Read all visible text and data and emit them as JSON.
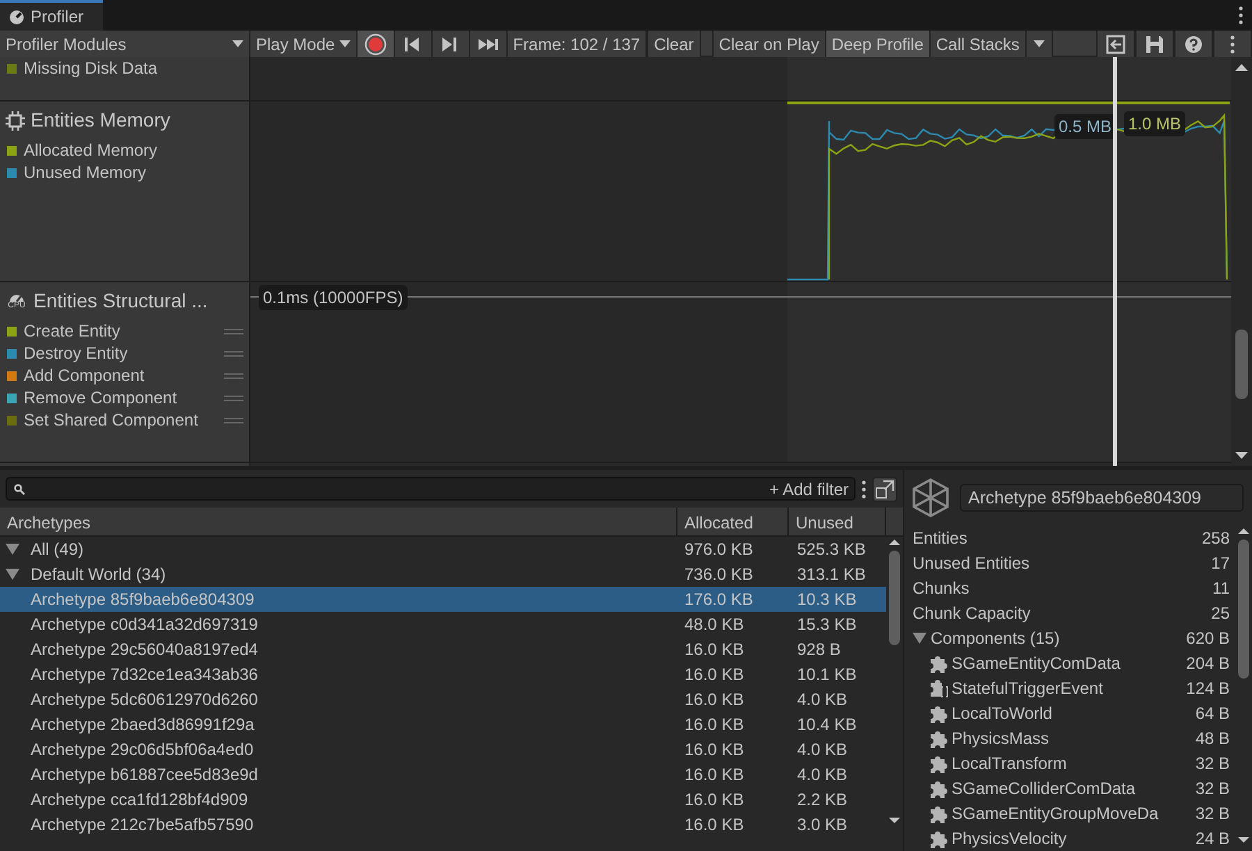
{
  "window": {
    "title": "Profiler"
  },
  "toolbar": {
    "modules_dropdown": "Profiler Modules",
    "play_mode": "Play Mode",
    "record": {
      "on": true
    },
    "frame": "Frame: 102 / 137",
    "clear": "Clear",
    "toggles": [
      {
        "label": "Clear on Play",
        "on": false
      },
      {
        "label": "Deep Profile",
        "on": true
      }
    ],
    "call_stacks": "Call Stacks"
  },
  "modules": [
    {
      "kind": "partial",
      "legend": [
        {
          "label": "Missing Disk Data",
          "color": "#6b7a14"
        }
      ]
    },
    {
      "kind": "memory",
      "title": "Entities Memory",
      "legend": [
        {
          "label": "Allocated Memory",
          "color": "#8ca313"
        },
        {
          "label": "Unused Memory",
          "color": "#2c8ab0"
        }
      ],
      "chart_labels": [
        "0.5 MB",
        "1.0 MB"
      ]
    },
    {
      "kind": "timing",
      "title": "Entities Structural ...",
      "icon_text": "CPU",
      "legend": [
        {
          "label": "Create Entity",
          "color": "#8ca313"
        },
        {
          "label": "Destroy Entity",
          "color": "#2c8ab0"
        },
        {
          "label": "Add Component",
          "color": "#d07a10"
        },
        {
          "label": "Remove Component",
          "color": "#3ba5b5"
        },
        {
          "label": "Set Shared Component",
          "color": "#6b6b10"
        }
      ],
      "chart_labels": [
        "0.1ms (10000FPS)"
      ]
    }
  ],
  "filter": {
    "button": "+ Add filter"
  },
  "table": {
    "columns": [
      "Archetypes",
      "Allocated",
      "Unused"
    ],
    "rows": [
      {
        "label": "All (49)",
        "allocated": "976.0 KB",
        "unused": "525.3 KB",
        "expanded": true,
        "selected": false
      },
      {
        "label": "Default World (34)",
        "allocated": "736.0 KB",
        "unused": "313.1 KB",
        "expanded": true,
        "selected": false,
        "children": [
          {
            "label": "Archetype 85f9baeb6e804309",
            "allocated": "176.0 KB",
            "unused": "10.3 KB",
            "selected": true
          },
          {
            "label": "Archetype c0d341a32d697319",
            "allocated": "48.0 KB",
            "unused": "15.3 KB",
            "selected": false
          },
          {
            "label": "Archetype 29c56040a8197ed4",
            "allocated": "16.0 KB",
            "unused": "928 B",
            "selected": false
          },
          {
            "label": "Archetype 7d32ce1ea343ab36",
            "allocated": "16.0 KB",
            "unused": "10.1 KB",
            "selected": false
          },
          {
            "label": "Archetype 5dc60612970d6260",
            "allocated": "16.0 KB",
            "unused": "4.0 KB",
            "selected": false
          },
          {
            "label": "Archetype 2baed3d86991f29a",
            "allocated": "16.0 KB",
            "unused": "10.4 KB",
            "selected": false
          },
          {
            "label": "Archetype 29c06d5bf06a4ed0",
            "allocated": "16.0 KB",
            "unused": "4.0 KB",
            "selected": false
          },
          {
            "label": "Archetype b61887cee5d83e9d",
            "allocated": "16.0 KB",
            "unused": "4.0 KB",
            "selected": false
          },
          {
            "label": "Archetype cca1fd128bf4d909",
            "allocated": "16.0 KB",
            "unused": "2.2 KB",
            "selected": false
          },
          {
            "label": "Archetype 212c7be5afb57590",
            "allocated": "16.0 KB",
            "unused": "3.0 KB",
            "selected": false
          }
        ]
      }
    ]
  },
  "details": {
    "name": "Archetype 85f9baeb6e804309",
    "stats": [
      {
        "label": "Entities",
        "value": "258"
      },
      {
        "label": "Unused Entities",
        "value": "17"
      },
      {
        "label": "Chunks",
        "value": "11"
      },
      {
        "label": "Chunk Capacity",
        "value": "25"
      }
    ],
    "components": {
      "label": "Components (15)",
      "value": "620 B",
      "expanded": true,
      "children": [
        {
          "kind": "component",
          "label": "SGameEntityComData",
          "value": "204 B"
        },
        {
          "kind": "buffer",
          "label": "StatefulTriggerEvent",
          "value": "124 B"
        },
        {
          "kind": "component",
          "label": "LocalToWorld",
          "value": "64 B"
        },
        {
          "kind": "component",
          "label": "PhysicsMass",
          "value": "48 B"
        },
        {
          "kind": "component",
          "label": "LocalTransform",
          "value": "32 B"
        },
        {
          "kind": "component",
          "label": "SGameColliderComData",
          "value": "32 B"
        },
        {
          "kind": "component",
          "label": "SGameEntityGroupMoveDa",
          "value": "32 B"
        },
        {
          "kind": "component",
          "label": "PhysicsVelocity",
          "value": "24 B"
        }
      ]
    }
  }
}
